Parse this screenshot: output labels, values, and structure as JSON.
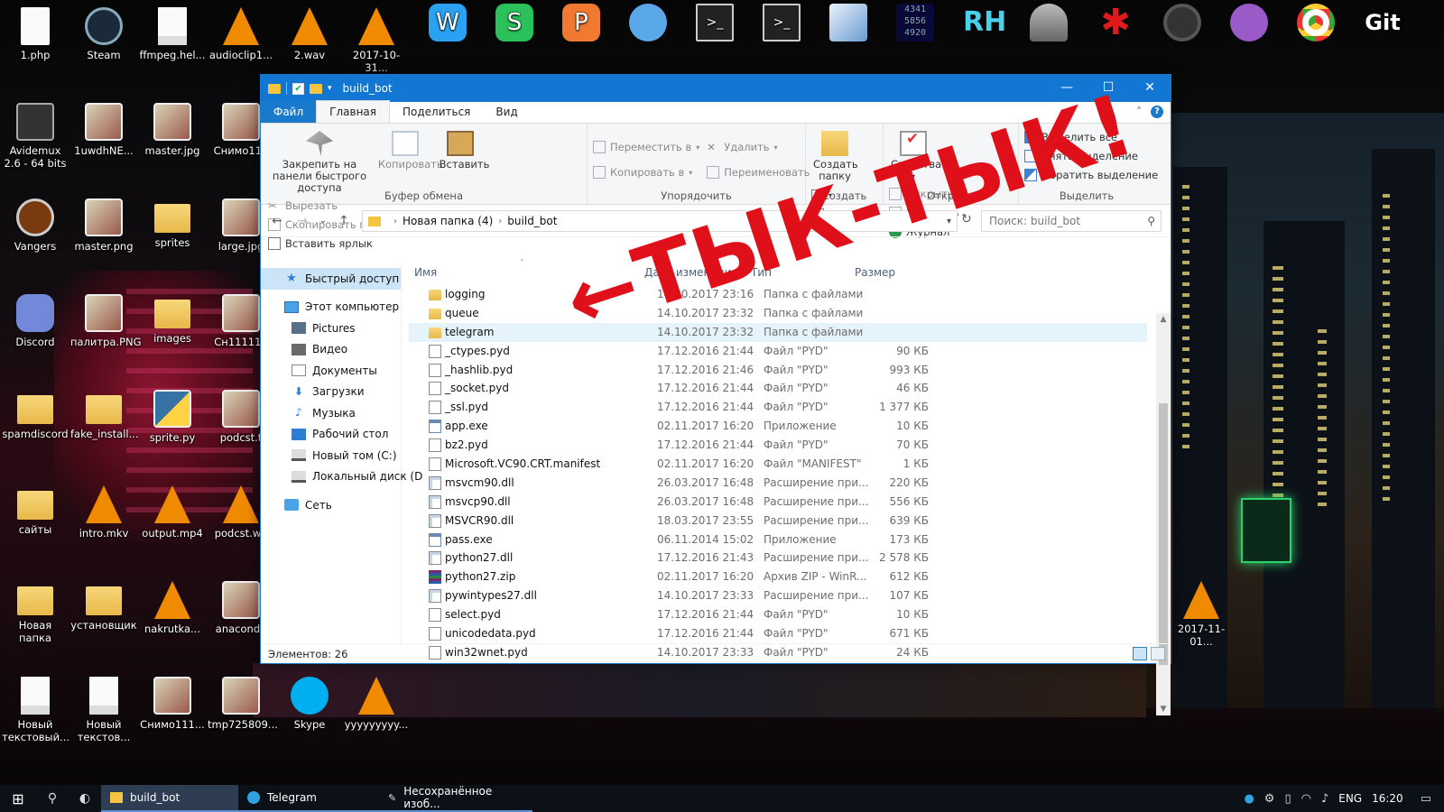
{
  "desktop": {
    "icons": [
      {
        "label": "1.php",
        "icon": "file-icon"
      },
      {
        "label": "Steam",
        "icon": "steam-icon"
      },
      {
        "label": "ffmpeg.hel...",
        "icon": "text-file-icon"
      },
      {
        "label": "audioclip1...",
        "icon": "vlc-icon"
      },
      {
        "label": "2.wav",
        "icon": "vlc-icon"
      },
      {
        "label": "2017-10-31...",
        "icon": "vlc-icon"
      },
      {
        "label": "Avidemux 2.6 - 64 bits",
        "icon": "avidemux-icon"
      },
      {
        "label": "1uwdhNE...",
        "icon": "image-icon"
      },
      {
        "label": "master.jpg",
        "icon": "image-icon"
      },
      {
        "label": "Снимо111",
        "icon": "image-icon"
      },
      {
        "label": "Vangers",
        "icon": "vangers-icon"
      },
      {
        "label": "master.png",
        "icon": "image-icon"
      },
      {
        "label": "sprites",
        "icon": "folder-icon"
      },
      {
        "label": "large.jpg",
        "icon": "image-icon"
      },
      {
        "label": "Discord",
        "icon": "discord-icon"
      },
      {
        "label": "палитра.PNG",
        "icon": "image-icon"
      },
      {
        "label": "images",
        "icon": "folder-icon"
      },
      {
        "label": "Сн111111",
        "icon": "image-icon"
      },
      {
        "label": "spamdiscord",
        "icon": "folder-icon"
      },
      {
        "label": "fake_install...",
        "icon": "folder-icon"
      },
      {
        "label": "sprite.py",
        "icon": "python-icon"
      },
      {
        "label": "podcst.t",
        "icon": "image-icon"
      },
      {
        "label": "сайты",
        "icon": "folder-icon"
      },
      {
        "label": "intro.mkv",
        "icon": "vlc-icon"
      },
      {
        "label": "output.mp4",
        "icon": "vlc-icon"
      },
      {
        "label": "podcst.wa",
        "icon": "vlc-icon"
      },
      {
        "label": "Новая папка",
        "icon": "folder-icon"
      },
      {
        "label": "установщик",
        "icon": "folder-icon"
      },
      {
        "label": "nakrutka...",
        "icon": "vlc-icon"
      },
      {
        "label": "anaconda",
        "icon": "image-icon"
      },
      {
        "label": "Новый текстовый...",
        "icon": "text-file-icon"
      },
      {
        "label": "Новый текстов...",
        "icon": "text-file-icon"
      },
      {
        "label": "Снимо111...",
        "icon": "image-icon"
      },
      {
        "label": "tmp725809...",
        "icon": "image-icon"
      },
      {
        "label": "Skype",
        "icon": "skype-icon"
      },
      {
        "label": "yyyyyyyyy...",
        "icon": "vlc-icon"
      },
      {
        "label": "2017-11-01...",
        "icon": "vlc-icon"
      }
    ],
    "top_right_icons": [
      "wps-writer-icon",
      "wps-spreadsheets-icon",
      "wps-presentation-icon",
      "settings-round-icon",
      "terminal-icon",
      "terminal-icon",
      "box-icon",
      "matrix-icon",
      "rh-icon",
      "wifi-router-icon",
      "red-star-icon",
      "dark-circle-icon",
      "github-icon",
      "chrome-icon",
      "git-icon"
    ],
    "top_right_texts": {
      "matrix": "4341\n5856\n4920",
      "rh": "RH",
      "git": "Git"
    }
  },
  "window": {
    "title": "build_bot",
    "quick_access_dd": "▾",
    "controls": {
      "minimize": "—",
      "maximize": "☐",
      "close": "✕"
    },
    "ribbon_tabs": [
      "Файл",
      "Главная",
      "Поделиться",
      "Вид"
    ],
    "ribbon_collapse": "˄",
    "help": "?",
    "ribbon": {
      "clipboard": {
        "pin_label": "Закрепить на панели быстрого доступа",
        "copy_label": "Копировать",
        "paste_label": "Вставить",
        "cut_label": "Вырезать",
        "copy_path_label": "Скопировать путь",
        "paste_shortcut_label": "Вставить ярлык",
        "group_label": "Буфер обмена"
      },
      "organize": {
        "move_label": "Переместить в",
        "copy_to_label": "Копировать в",
        "delete_label": "Удалить",
        "rename_label": "Переименовать",
        "group_label": "Упорядочить"
      },
      "new": {
        "new_folder_label": "Создать папку",
        "group_label": "Создать"
      },
      "open": {
        "properties_label": "Свойства",
        "open_label": "Открыть",
        "edit_label": "Изменить",
        "history_label": "Журнал",
        "group_label": "Открыть"
      },
      "select": {
        "select_all_label": "Выделить все",
        "select_none_label": "Снять выделение",
        "invert_label": "Обратить выделение",
        "group_label": "Выделить"
      }
    },
    "address": {
      "back": "←",
      "forward": "→",
      "recent": "⌄",
      "up": "↑",
      "crumbs": [
        "Новая папка (4)",
        "build_bot"
      ],
      "search_placeholder": "Поиск: build_bot",
      "refresh": "↻"
    },
    "nav_pane": [
      {
        "label": "Быстрый доступ",
        "icon": "quick-access-star-icon"
      },
      {
        "label": "Этот компьютер",
        "icon": "this-pc-icon"
      },
      {
        "label": "Pictures",
        "icon": "pictures-icon"
      },
      {
        "label": "Видео",
        "icon": "video-icon"
      },
      {
        "label": "Документы",
        "icon": "documents-icon"
      },
      {
        "label": "Загрузки",
        "icon": "downloads-icon"
      },
      {
        "label": "Музыка",
        "icon": "music-icon"
      },
      {
        "label": "Рабочий стол",
        "icon": "desktop-icon"
      },
      {
        "label": "Новый том (C:)",
        "icon": "drive-icon"
      },
      {
        "label": "Локальный диск (D",
        "icon": "drive-icon"
      },
      {
        "label": "Сеть",
        "icon": "network-icon"
      }
    ],
    "columns": {
      "name": "Имя",
      "date": "Дата изменения",
      "type": "Тип",
      "size": "Размер"
    },
    "files": [
      {
        "name": "logging",
        "date": "14.10.2017 23:16",
        "type": "Папка с файлами",
        "size": "",
        "kind": "folder"
      },
      {
        "name": "queue",
        "date": "14.10.2017 23:32",
        "type": "Папка с файлами",
        "size": "",
        "kind": "folder"
      },
      {
        "name": "telegram",
        "date": "14.10.2017 23:32",
        "type": "Папка с файлами",
        "size": "",
        "kind": "folder"
      },
      {
        "name": "_ctypes.pyd",
        "date": "17.12.2016 21:44",
        "type": "Файл \"PYD\"",
        "size": "90 КБ",
        "kind": "file"
      },
      {
        "name": "_hashlib.pyd",
        "date": "17.12.2016 21:46",
        "type": "Файл \"PYD\"",
        "size": "993 КБ",
        "kind": "file"
      },
      {
        "name": "_socket.pyd",
        "date": "17.12.2016 21:44",
        "type": "Файл \"PYD\"",
        "size": "46 КБ",
        "kind": "file"
      },
      {
        "name": "_ssl.pyd",
        "date": "17.12.2016 21:44",
        "type": "Файл \"PYD\"",
        "size": "1 377 КБ",
        "kind": "file"
      },
      {
        "name": "app.exe",
        "date": "02.11.2017 16:20",
        "type": "Приложение",
        "size": "10 КБ",
        "kind": "exe"
      },
      {
        "name": "bz2.pyd",
        "date": "17.12.2016 21:44",
        "type": "Файл \"PYD\"",
        "size": "70 КБ",
        "kind": "file"
      },
      {
        "name": "Microsoft.VC90.CRT.manifest",
        "date": "02.11.2017 16:20",
        "type": "Файл \"MANIFEST\"",
        "size": "1 КБ",
        "kind": "file"
      },
      {
        "name": "msvcm90.dll",
        "date": "26.03.2017 16:48",
        "type": "Расширение при...",
        "size": "220 КБ",
        "kind": "dll"
      },
      {
        "name": "msvcp90.dll",
        "date": "26.03.2017 16:48",
        "type": "Расширение при...",
        "size": "556 КБ",
        "kind": "dll"
      },
      {
        "name": "MSVCR90.dll",
        "date": "18.03.2017 23:55",
        "type": "Расширение при...",
        "size": "639 КБ",
        "kind": "dll"
      },
      {
        "name": "pass.exe",
        "date": "06.11.2014 15:02",
        "type": "Приложение",
        "size": "173 КБ",
        "kind": "exe"
      },
      {
        "name": "python27.dll",
        "date": "17.12.2016 21:43",
        "type": "Расширение при...",
        "size": "2 578 КБ",
        "kind": "dll"
      },
      {
        "name": "python27.zip",
        "date": "02.11.2017 16:20",
        "type": "Архив ZIP - WinR...",
        "size": "612 КБ",
        "kind": "zip"
      },
      {
        "name": "pywintypes27.dll",
        "date": "14.10.2017 23:33",
        "type": "Расширение при...",
        "size": "107 КБ",
        "kind": "dll"
      },
      {
        "name": "select.pyd",
        "date": "17.12.2016 21:44",
        "type": "Файл \"PYD\"",
        "size": "10 КБ",
        "kind": "file"
      },
      {
        "name": "unicodedata.pyd",
        "date": "17.12.2016 21:44",
        "type": "Файл \"PYD\"",
        "size": "671 КБ",
        "kind": "file"
      },
      {
        "name": "win32wnet.pyd",
        "date": "14.10.2017 23:33",
        "type": "Файл \"PYD\"",
        "size": "24 КБ",
        "kind": "file"
      }
    ],
    "status": "Элементов: 26"
  },
  "annotation": {
    "text": "←ТЫК-ТЫК!",
    "color": "#e0101a"
  },
  "taskbar": {
    "apps": [
      {
        "label": "build_bot",
        "icon": "folder-icon",
        "active": true
      },
      {
        "label": "Telegram",
        "icon": "telegram-icon",
        "active": false
      },
      {
        "label": "Несохранённое изоб...",
        "icon": "paint-icon",
        "active": false
      }
    ],
    "tray": {
      "lang": "ENG",
      "time": "16:20"
    }
  },
  "colors": {
    "titlebar": "#1177d2",
    "file_tab": "#1979ca",
    "selection": "#cce4f7",
    "hover": "#e5f3fb",
    "annotation": "#e0101a"
  }
}
